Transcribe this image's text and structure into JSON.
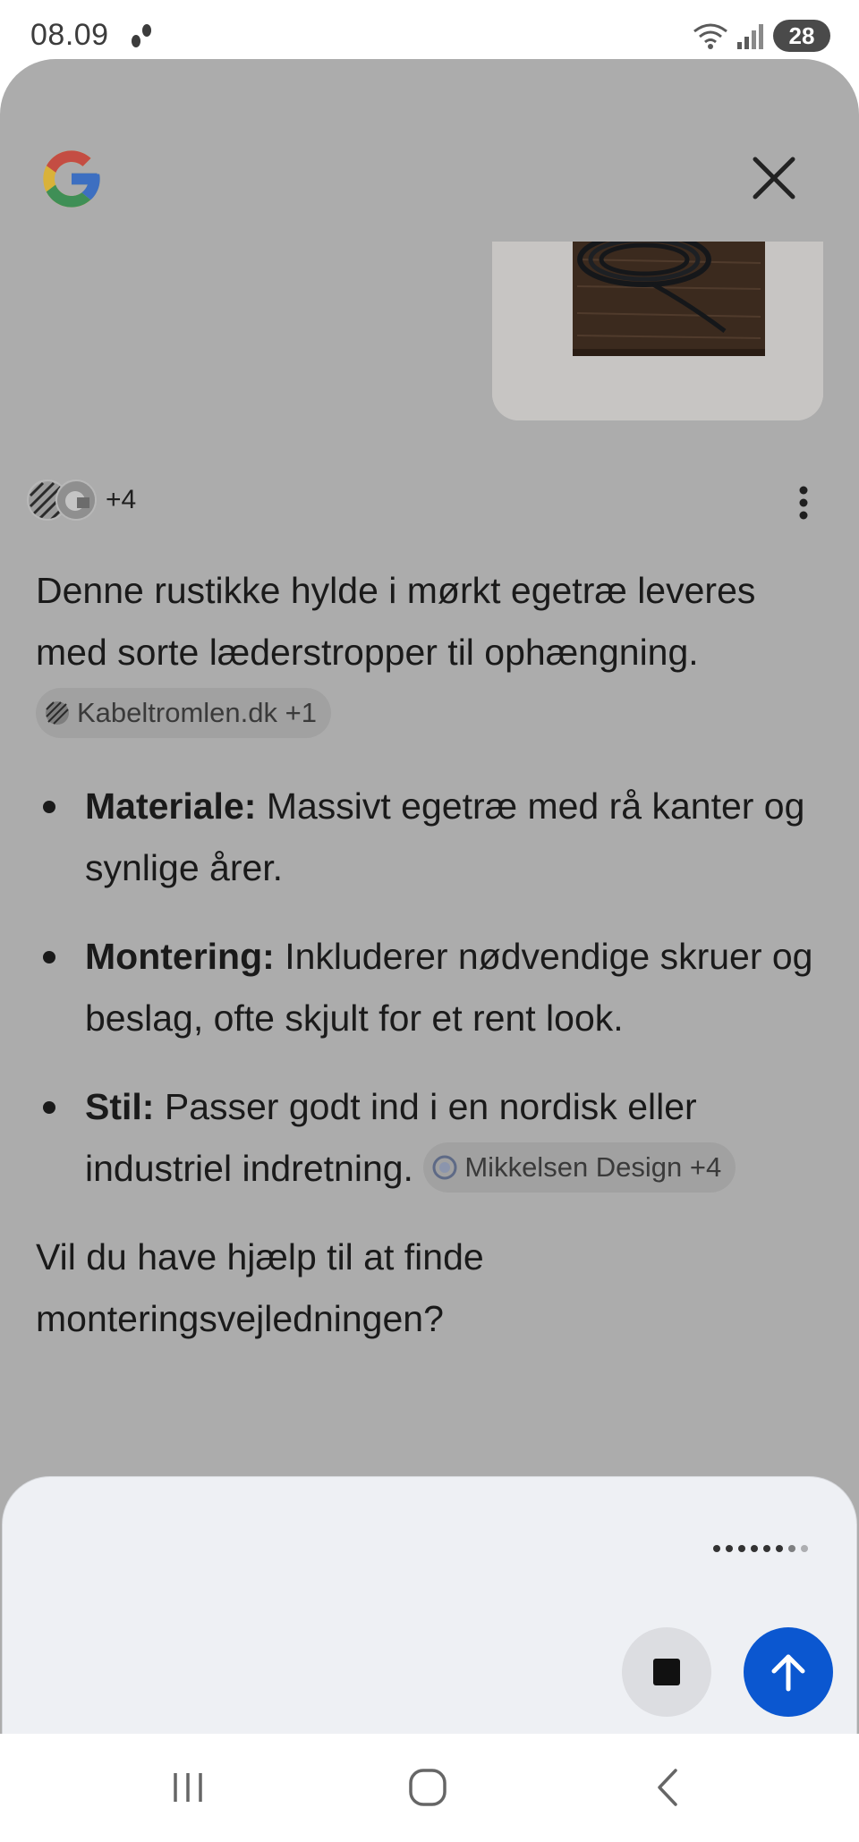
{
  "status_bar": {
    "time": "08.09",
    "battery": "28",
    "icons": [
      "steps-icon",
      "wifi-icon",
      "signal-icon",
      "battery-icon"
    ]
  },
  "header": {
    "logo": "google-g-icon",
    "close_icon": "close-icon"
  },
  "sources": {
    "count_label": "+4",
    "more_icon": "more-vert-icon"
  },
  "answer": {
    "intro": "Denne rustikke hylde i mørkt egetræ leveres med sorte læderstropper til ophængning.",
    "intro_chip": "Kabeltromlen.dk +1",
    "bullets": [
      {
        "label": "Materiale:",
        "text": "Massivt egetræ med rå kanter og synlige årer."
      },
      {
        "label": "Montering:",
        "text": "Inkluderer nødvendige skruer og beslag, ofte skjult for et rent look."
      },
      {
        "label": "Stil:",
        "text": "Passer godt ind i en nordisk eller industriel indretning."
      }
    ],
    "bullet3_chip": "Mikkelsen Design +4",
    "followup": "Vil du have hjælp til at finde monteringsvejledningen?"
  },
  "input": {
    "placeholder": "",
    "stop_icon": "stop-icon",
    "send_icon": "arrow-up-icon"
  },
  "nav": {
    "recents_icon": "recents-icon",
    "home_icon": "home-icon",
    "back_icon": "back-icon"
  },
  "colors": {
    "panel_overlay": "#acacac",
    "send_button": "#0b57d0",
    "input_panel": "#eef0f4"
  }
}
